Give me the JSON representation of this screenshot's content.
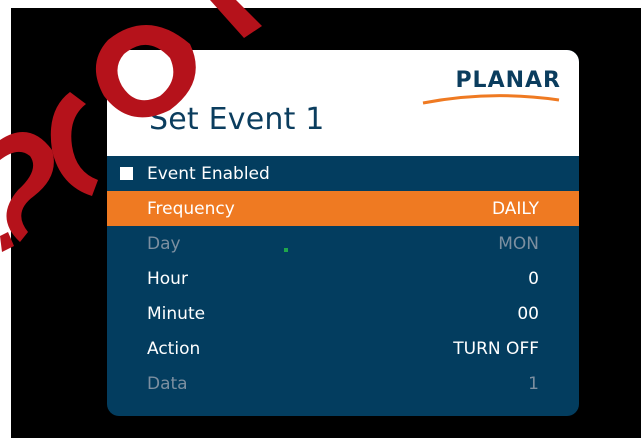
{
  "panel": {
    "title": "Set Event 1",
    "logo_text": "PLANAR"
  },
  "menu": {
    "event_enabled": {
      "label": "Event Enabled",
      "checked": true
    },
    "rows": [
      {
        "label": "Frequency",
        "value": "DAILY",
        "state": "highlighted"
      },
      {
        "label": "Day",
        "value": "MON",
        "state": "disabled"
      },
      {
        "label": "Hour",
        "value": "0",
        "state": "normal"
      },
      {
        "label": "Minute",
        "value": "00",
        "state": "normal"
      },
      {
        "label": "Action",
        "value": "TURN OFF",
        "state": "normal"
      },
      {
        "label": "Data",
        "value": "1",
        "state": "disabled"
      }
    ]
  },
  "colors": {
    "panel_blue": "#033d5f",
    "highlight_orange": "#ef7a22",
    "disabled_text": "#7c8fa0",
    "watermark_red": "#b5121b"
  }
}
